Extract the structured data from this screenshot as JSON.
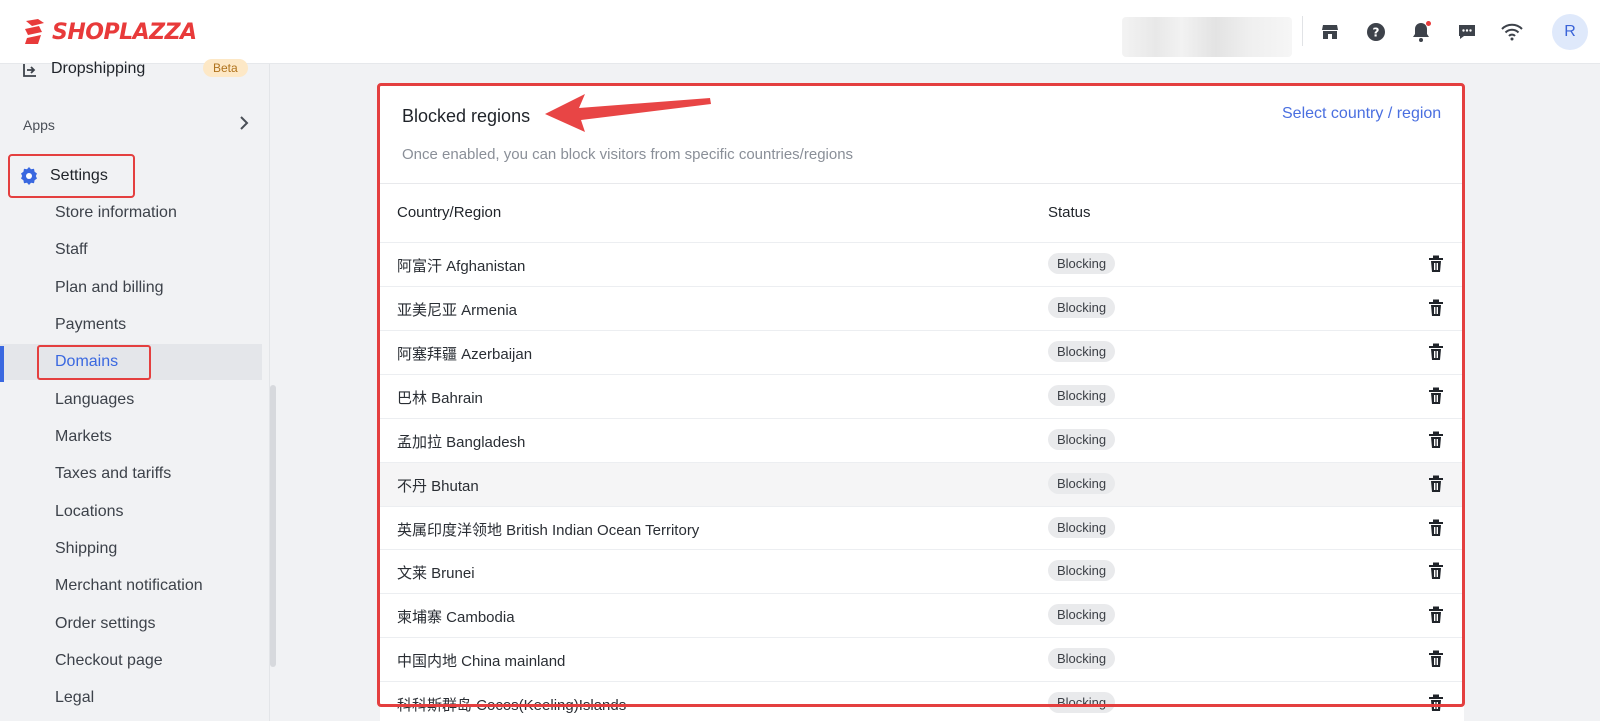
{
  "brand": {
    "name": "SHOPLAZZA",
    "color": "#e83a3a"
  },
  "topbar": {
    "icons": [
      "store-icon",
      "help-icon",
      "bell-icon",
      "chat-icon",
      "wifi-icon"
    ],
    "avatar_initial": "R"
  },
  "sidebar": {
    "dropshipping": {
      "label": "Dropshipping",
      "badge": "Beta"
    },
    "apps": {
      "label": "Apps"
    },
    "settings": {
      "label": "Settings"
    },
    "items": [
      {
        "label": "Store information"
      },
      {
        "label": "Staff"
      },
      {
        "label": "Plan and billing"
      },
      {
        "label": "Payments"
      },
      {
        "label": "Domains",
        "active": true
      },
      {
        "label": "Languages"
      },
      {
        "label": "Markets"
      },
      {
        "label": "Taxes and tariffs"
      },
      {
        "label": "Locations"
      },
      {
        "label": "Shipping"
      },
      {
        "label": "Merchant notification"
      },
      {
        "label": "Order settings"
      },
      {
        "label": "Checkout page"
      },
      {
        "label": "Legal"
      }
    ]
  },
  "card": {
    "title": "Blocked regions",
    "subtitle": "Once enabled, you can block visitors from specific countries/regions",
    "action_link": "Select country / region",
    "columns": {
      "country": "Country/Region",
      "status": "Status"
    },
    "rows": [
      {
        "country": "阿富汗 Afghanistan",
        "status": "Blocking"
      },
      {
        "country": "亚美尼亚 Armenia",
        "status": "Blocking"
      },
      {
        "country": "阿塞拜疆 Azerbaijan",
        "status": "Blocking"
      },
      {
        "country": "巴林 Bahrain",
        "status": "Blocking"
      },
      {
        "country": "孟加拉 Bangladesh",
        "status": "Blocking"
      },
      {
        "country": "不丹 Bhutan",
        "status": "Blocking"
      },
      {
        "country": "英属印度洋领地 British Indian Ocean Territory",
        "status": "Blocking"
      },
      {
        "country": "文莱 Brunei",
        "status": "Blocking"
      },
      {
        "country": "柬埔寨 Cambodia",
        "status": "Blocking"
      },
      {
        "country": "中国内地 China mainland",
        "status": "Blocking"
      },
      {
        "country": "科科斯群岛 Cocos(Keeling)Islands",
        "status": "Blocking"
      }
    ]
  },
  "colors": {
    "accent": "#3a68e0",
    "highlight": "#e43f3f"
  }
}
